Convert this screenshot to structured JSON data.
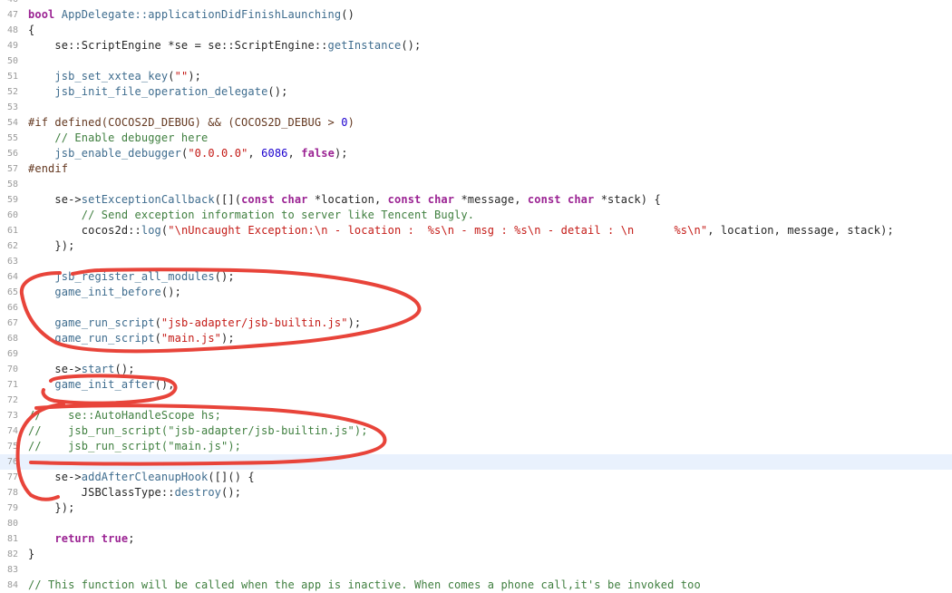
{
  "editor": {
    "current_line": 76,
    "lines": [
      {
        "n": "46",
        "t": []
      },
      {
        "n": "47",
        "t": [
          [
            "k",
            "bool "
          ],
          [
            "f",
            "AppDelegate::applicationDidFinishLaunching"
          ],
          [
            "t",
            "()"
          ]
        ]
      },
      {
        "n": "48",
        "t": [
          [
            "t",
            "{"
          ]
        ]
      },
      {
        "n": "49",
        "t": [
          [
            "t",
            "    se::ScriptEngine *se = se::ScriptEngine::"
          ],
          [
            "f",
            "getInstance"
          ],
          [
            "t",
            "();"
          ]
        ]
      },
      {
        "n": "50",
        "t": []
      },
      {
        "n": "51",
        "t": [
          [
            "t",
            "    "
          ],
          [
            "f",
            "jsb_set_xxtea_key"
          ],
          [
            "t",
            "("
          ],
          [
            "s",
            "\"\""
          ],
          [
            "t",
            ");"
          ]
        ]
      },
      {
        "n": "52",
        "t": [
          [
            "t",
            "    "
          ],
          [
            "f",
            "jsb_init_file_operation_delegate"
          ],
          [
            "t",
            "();"
          ]
        ]
      },
      {
        "n": "53",
        "t": []
      },
      {
        "n": "54",
        "t": [
          [
            "p",
            "#if defined(COCOS2D_DEBUG) && (COCOS2D_DEBUG > "
          ],
          [
            "n",
            "0"
          ],
          [
            "p",
            ")"
          ]
        ]
      },
      {
        "n": "55",
        "t": [
          [
            "c",
            "    // Enable debugger here"
          ]
        ]
      },
      {
        "n": "56",
        "t": [
          [
            "t",
            "    "
          ],
          [
            "f",
            "jsb_enable_debugger"
          ],
          [
            "t",
            "("
          ],
          [
            "s",
            "\"0.0.0.0\""
          ],
          [
            "t",
            ", "
          ],
          [
            "n",
            "6086"
          ],
          [
            "t",
            ", "
          ],
          [
            "k",
            "false"
          ],
          [
            "t",
            ");"
          ]
        ]
      },
      {
        "n": "57",
        "t": [
          [
            "p",
            "#endif"
          ]
        ]
      },
      {
        "n": "58",
        "t": []
      },
      {
        "n": "59",
        "t": [
          [
            "t",
            "    se->"
          ],
          [
            "f",
            "setExceptionCallback"
          ],
          [
            "t",
            "([]("
          ],
          [
            "k",
            "const char "
          ],
          [
            "t",
            "*location, "
          ],
          [
            "k",
            "const char "
          ],
          [
            "t",
            "*message, "
          ],
          [
            "k",
            "const char "
          ],
          [
            "t",
            "*stack) {"
          ]
        ]
      },
      {
        "n": "60",
        "t": [
          [
            "c",
            "        // Send exception information to server like Tencent Bugly."
          ]
        ]
      },
      {
        "n": "61",
        "t": [
          [
            "t",
            "        cocos2d::"
          ],
          [
            "f",
            "log"
          ],
          [
            "t",
            "("
          ],
          [
            "s",
            "\"\\nUncaught Exception:\\n - location :  %s\\n - msg : %s\\n - detail : \\n      %s\\n\""
          ],
          [
            "t",
            ", location, message, stack);"
          ]
        ]
      },
      {
        "n": "62",
        "t": [
          [
            "t",
            "    });"
          ]
        ]
      },
      {
        "n": "63",
        "t": []
      },
      {
        "n": "64",
        "t": [
          [
            "t",
            "    "
          ],
          [
            "f",
            "jsb_register_all_modules"
          ],
          [
            "t",
            "();"
          ]
        ]
      },
      {
        "n": "65",
        "t": [
          [
            "t",
            "    "
          ],
          [
            "f",
            "game_init_before"
          ],
          [
            "t",
            "();"
          ]
        ]
      },
      {
        "n": "66",
        "t": []
      },
      {
        "n": "67",
        "t": [
          [
            "t",
            "    "
          ],
          [
            "f",
            "game_run_script"
          ],
          [
            "t",
            "("
          ],
          [
            "s",
            "\"jsb-adapter/jsb-builtin.js\""
          ],
          [
            "t",
            ");"
          ]
        ]
      },
      {
        "n": "68",
        "t": [
          [
            "t",
            "    "
          ],
          [
            "f",
            "game_run_script"
          ],
          [
            "t",
            "("
          ],
          [
            "s",
            "\"main.js\""
          ],
          [
            "t",
            ");"
          ]
        ]
      },
      {
        "n": "69",
        "t": []
      },
      {
        "n": "70",
        "t": [
          [
            "t",
            "    se->"
          ],
          [
            "f",
            "start"
          ],
          [
            "t",
            "();"
          ]
        ]
      },
      {
        "n": "71",
        "t": [
          [
            "t",
            "    "
          ],
          [
            "f",
            "game_init_after"
          ],
          [
            "t",
            "();"
          ]
        ]
      },
      {
        "n": "72",
        "t": []
      },
      {
        "n": "73",
        "t": [
          [
            "c",
            "//    se::AutoHandleScope hs;"
          ]
        ]
      },
      {
        "n": "74",
        "t": [
          [
            "c",
            "//    jsb_run_script(\"jsb-adapter/jsb-builtin.js\");"
          ]
        ]
      },
      {
        "n": "75",
        "t": [
          [
            "c",
            "//    jsb_run_script(\"main.js\");"
          ]
        ]
      },
      {
        "n": "76",
        "t": []
      },
      {
        "n": "77",
        "t": [
          [
            "t",
            "    se->"
          ],
          [
            "f",
            "addAfterCleanupHook"
          ],
          [
            "t",
            "([]() {"
          ]
        ]
      },
      {
        "n": "78",
        "t": [
          [
            "t",
            "        JSBClassType::"
          ],
          [
            "f",
            "destroy"
          ],
          [
            "t",
            "();"
          ]
        ]
      },
      {
        "n": "79",
        "t": [
          [
            "t",
            "    });"
          ]
        ]
      },
      {
        "n": "80",
        "t": []
      },
      {
        "n": "81",
        "t": [
          [
            "t",
            "    "
          ],
          [
            "k",
            "return true"
          ],
          [
            "t",
            ";"
          ]
        ]
      },
      {
        "n": "82",
        "t": [
          [
            "t",
            "}"
          ]
        ]
      },
      {
        "n": "83",
        "t": []
      },
      {
        "n": "84",
        "t": [
          [
            "c",
            "// This function will be called when the app is inactive. When comes a phone call,it's be invoked too"
          ]
        ]
      }
    ]
  },
  "annotation": {
    "color": "#e8443a"
  }
}
